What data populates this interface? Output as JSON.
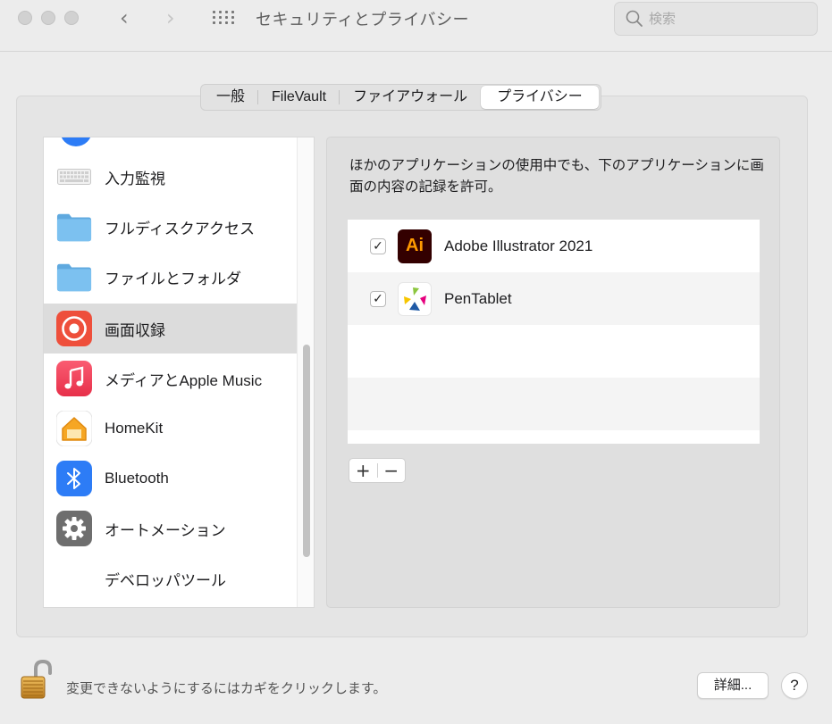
{
  "window": {
    "title": "セキュリティとプライバシー",
    "search_placeholder": "検索"
  },
  "tabs": [
    {
      "label": "一般",
      "active": false
    },
    {
      "label": "FileVault",
      "active": false
    },
    {
      "label": "ファイアウォール",
      "active": false
    },
    {
      "label": "プライバシー",
      "active": true
    }
  ],
  "sidebar": {
    "items": [
      {
        "label": "入力監視",
        "icon": "keyboard-icon"
      },
      {
        "label": "フルディスクアクセス",
        "icon": "folder-icon"
      },
      {
        "label": "ファイルとフォルダ",
        "icon": "folder-icon"
      },
      {
        "label": "画面収録",
        "icon": "screen-recording-icon",
        "selected": true
      },
      {
        "label": "メディアとApple Music",
        "icon": "music-icon"
      },
      {
        "label": "HomeKit",
        "icon": "home-icon"
      },
      {
        "label": "Bluetooth",
        "icon": "bluetooth-icon"
      },
      {
        "label": "オートメーション",
        "icon": "gear-icon"
      },
      {
        "label": "デベロッパツール",
        "icon": ""
      }
    ]
  },
  "content": {
    "description": "ほかのアプリケーションの使用中でも、下のアプリケーションに画面の内容の記録を許可。",
    "apps": [
      {
        "name": "Adobe Illustrator 2021",
        "checked": true,
        "icon_text": "Ai",
        "icon": "adobe-illustrator-icon"
      },
      {
        "name": "PenTablet",
        "checked": true,
        "icon": "pentablet-icon"
      }
    ],
    "add_label": "+",
    "remove_label": "−",
    "check_mark": "✓"
  },
  "footer": {
    "lock_text": "変更できないようにするにはカギをクリックします。",
    "details_label": "詳細...",
    "help_label": "?"
  },
  "colors": {
    "illustrator_bg": "#330000",
    "illustrator_fg": "#ff9a00",
    "screen_recording": "#ee4f3b",
    "music": "#f5455c",
    "bluetooth": "#2d7cf6",
    "folder": "#6cb6ea"
  }
}
